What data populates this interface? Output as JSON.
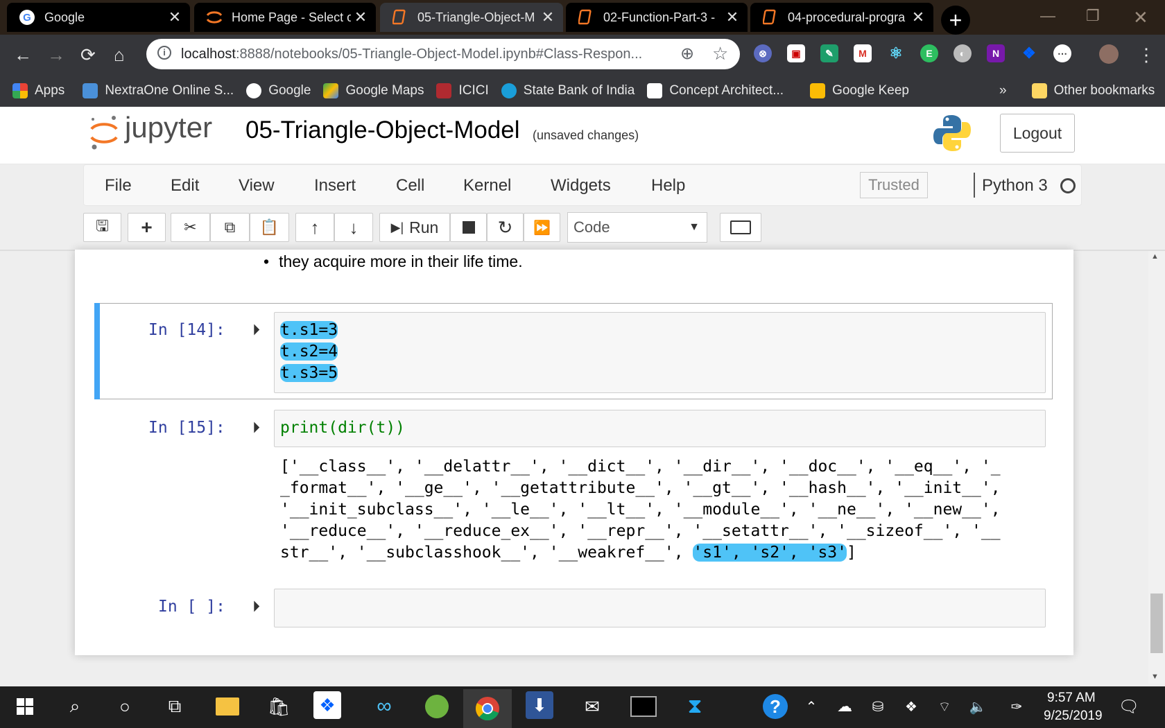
{
  "browser": {
    "tabs": [
      {
        "title": "Google",
        "icon": "google-icon"
      },
      {
        "title": "Home Page - Select or",
        "icon": "jupyter-icon"
      },
      {
        "title": "05-Triangle-Object-M",
        "icon": "notebook-icon"
      },
      {
        "title": "02-Function-Part-3 -",
        "icon": "notebook-icon"
      },
      {
        "title": "04-procedural-progra",
        "icon": "notebook-icon"
      }
    ],
    "new_tab": "+",
    "url_host": "localhost",
    "url_rest": ":8888/notebooks/05-Triangle-Object-Model.ipynb#Class-Respon...",
    "bookmarks": [
      "Apps",
      "NextraOne Online S...",
      "Google",
      "Google Maps",
      "ICICI",
      "State Bank of India",
      "Concept Architect...",
      "Google Keep"
    ],
    "bookmarks_more": "»",
    "other_bookmarks": "Other bookmarks"
  },
  "jupyter": {
    "logo_text": "jupyter",
    "notebook_title": "05-Triangle-Object-Model",
    "save_status": "(unsaved changes)",
    "logout": "Logout",
    "menu": [
      "File",
      "Edit",
      "View",
      "Insert",
      "Cell",
      "Kernel",
      "Widgets",
      "Help"
    ],
    "trusted": "Trusted",
    "kernel_name": "Python 3",
    "run_label": "Run",
    "cell_type": "Code"
  },
  "notebook": {
    "bullet_text": "they acquire more in their life time.",
    "cells": [
      {
        "prompt": "In [14]:",
        "lines": [
          "t.s1=3",
          "t.s2=4",
          "t.s3=5"
        ]
      },
      {
        "prompt": "In [15]:",
        "code": "print(dir(t))",
        "output": [
          "['__class__', '__delattr__', '__dict__', '__dir__', '__doc__', '__eq__', '_",
          "_format__', '__ge__', '__getattribute__', '__gt__', '__hash__', '__init__',",
          "'__init_subclass__', '__le__', '__lt__', '__module__', '__ne__', '__new__',",
          "'__reduce__', '__reduce_ex__', '__repr__', '__setattr__', '__sizeof__', '__",
          "str__', '__subclasshook__', '__weakref__', ",
          "'s1', 's2', 's3'",
          "]"
        ]
      },
      {
        "prompt": "In [ ]:"
      }
    ]
  },
  "taskbar": {
    "time": "9:57 AM",
    "date": "9/25/2019"
  },
  "colors": {
    "highlight": "#4fc3f7",
    "cell_selected_bar": "#42a5f5",
    "prompt": "#303f9f"
  }
}
